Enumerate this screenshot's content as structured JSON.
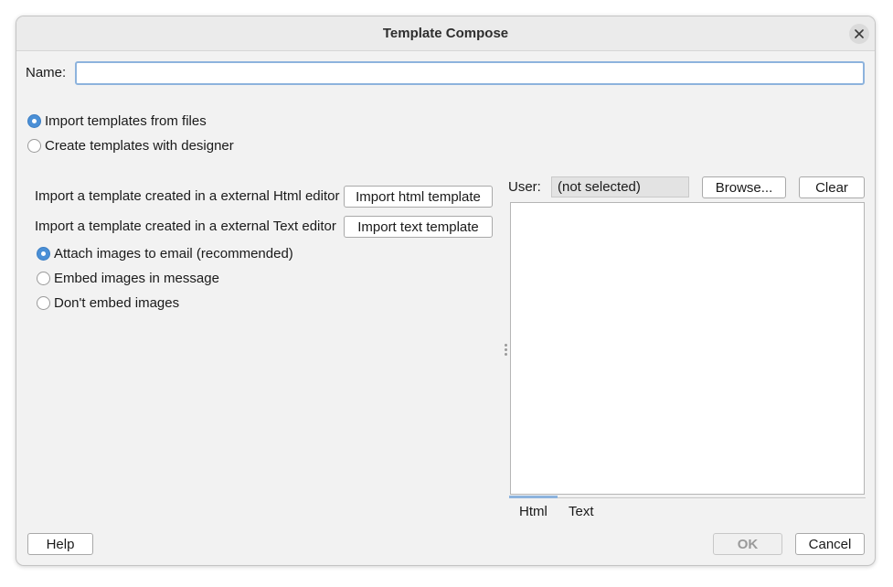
{
  "window": {
    "title": "Template Compose"
  },
  "name": {
    "label": "Name:",
    "value": "",
    "placeholder": ""
  },
  "mode": {
    "options": [
      {
        "label": "Import templates from files",
        "checked": true
      },
      {
        "label": "Create templates with designer",
        "checked": false
      }
    ]
  },
  "import": {
    "html_label": "Import a template created in a external Html editor",
    "html_button": "Import html template",
    "text_label": "Import a template created in a external Text editor",
    "text_button": "Import text template"
  },
  "images": {
    "options": [
      {
        "label": "Attach images to email (recommended)",
        "checked": true
      },
      {
        "label": "Embed images in message",
        "checked": false
      },
      {
        "label": "Don't embed images",
        "checked": false
      }
    ]
  },
  "user": {
    "label": "User:",
    "value": "(not selected)",
    "browse_button": "Browse...",
    "clear_button": "Clear"
  },
  "tabs": [
    {
      "label": "Html",
      "active": true
    },
    {
      "label": "Text",
      "active": false
    }
  ],
  "footer": {
    "help_button": "Help",
    "ok_button": "OK",
    "cancel_button": "Cancel"
  },
  "colors": {
    "accent": "#4a8fd6",
    "focus_border": "#8db3dd"
  }
}
